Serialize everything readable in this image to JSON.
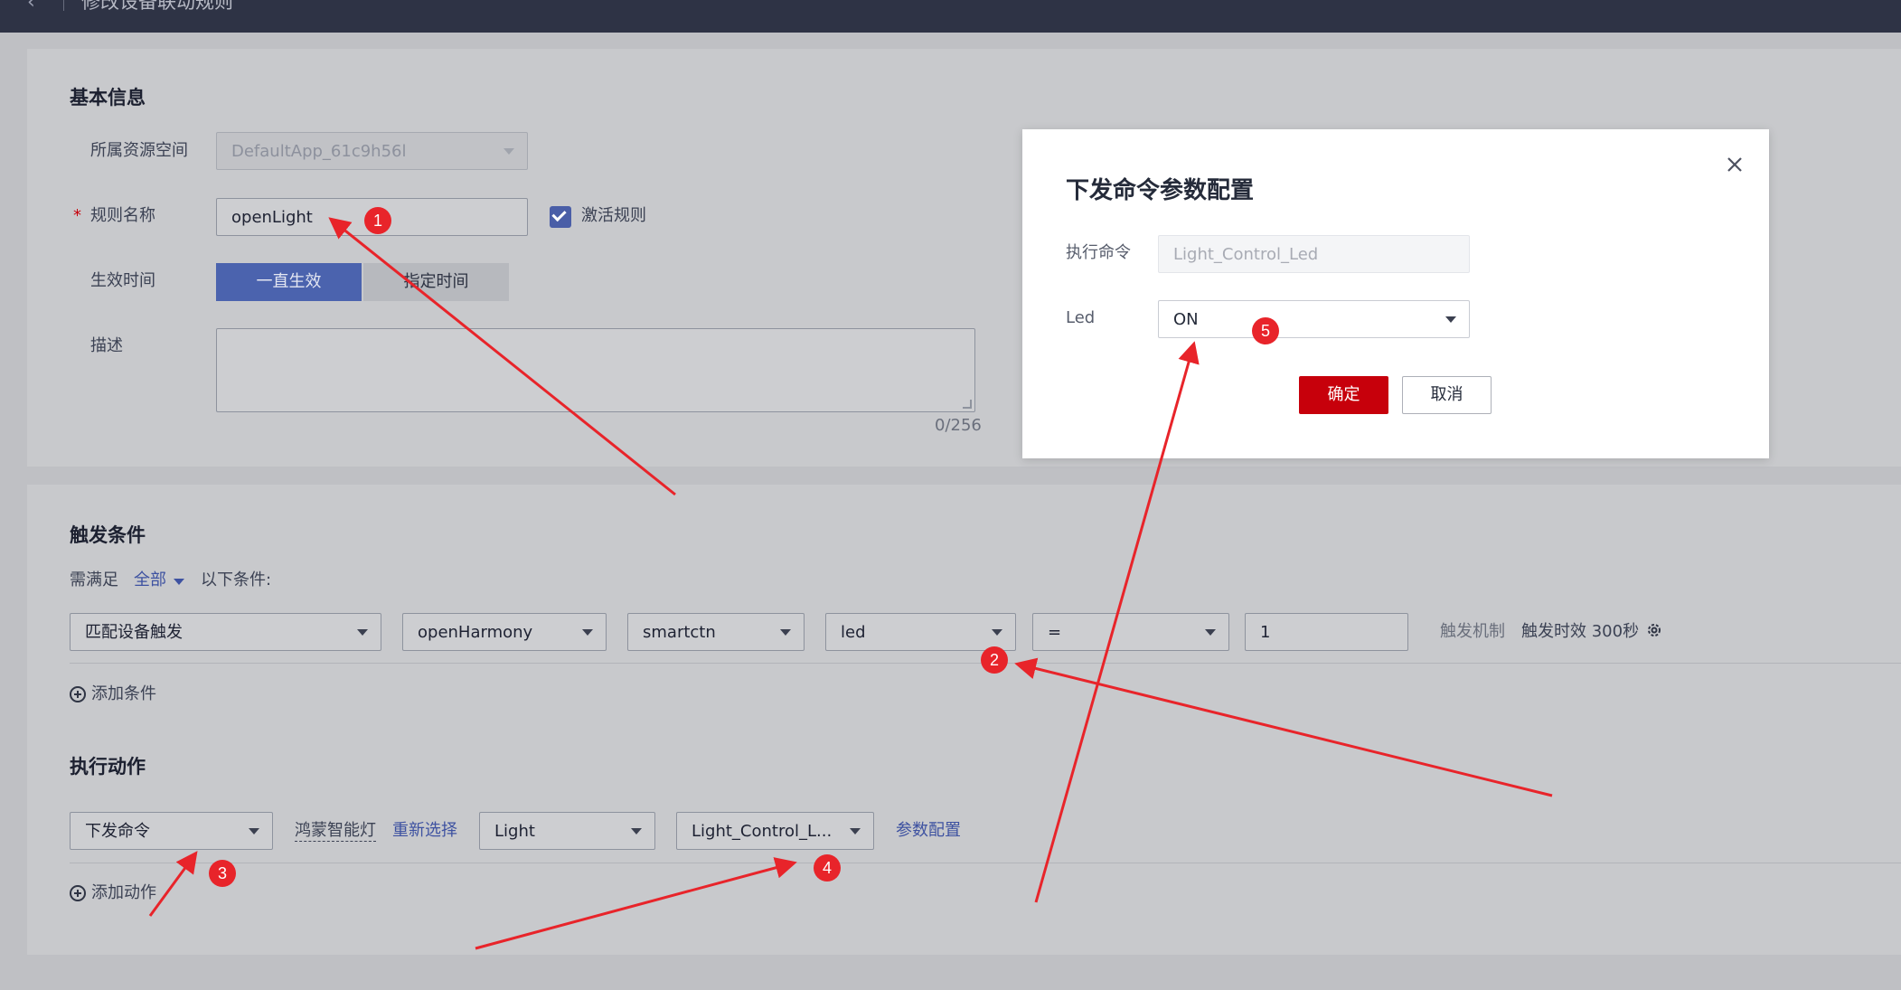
{
  "header": {
    "title": "修改设备联动规则"
  },
  "basic": {
    "section_title": "基本信息",
    "resource_space_label": "所属资源空间",
    "resource_space_value": "DefaultApp_61c9h56l",
    "rule_name_required": "*",
    "rule_name_label": "规则名称",
    "rule_name_value": "openLight",
    "activate_label": "激活规则",
    "effective_label": "生效时间",
    "effective_always": "一直生效",
    "effective_specified": "指定时间",
    "desc_label": "描述",
    "desc_counter": "0/256"
  },
  "trigger": {
    "section_title": "触发条件",
    "satisfy_prefix": "需满足",
    "satisfy_value": "全部",
    "satisfy_suffix": "以下条件:",
    "fields": [
      "匹配设备触发",
      "openHarmony",
      "smartctn",
      "led",
      "=",
      "1"
    ],
    "mechanism_label": "触发机制",
    "timeout_text": "触发时效 300秒",
    "add_condition": "添加条件"
  },
  "action": {
    "section_title": "执行动作",
    "type_value": "下发命令",
    "device_name": "鸿蒙智能灯",
    "reselect": "重新选择",
    "service_value": "Light",
    "command_value": "Light_Control_L...",
    "param_config": "参数配置",
    "add_action": "添加动作"
  },
  "modal": {
    "title": "下发命令参数配置",
    "command_label": "执行命令",
    "command_value": "Light_Control_Led",
    "led_label": "Led",
    "led_value": "ON",
    "confirm": "确定",
    "cancel": "取消"
  },
  "annotations": [
    "1",
    "2",
    "3",
    "4",
    "5"
  ],
  "colors": {
    "accent": "#4b63ae",
    "primary_button": "#c7000b",
    "annotation": "#e8242a"
  }
}
